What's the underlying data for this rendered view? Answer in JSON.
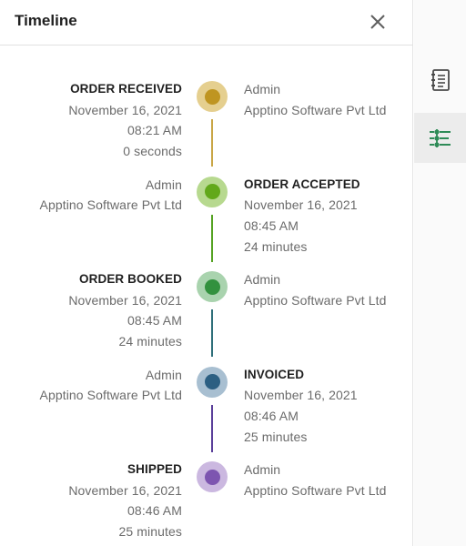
{
  "header": {
    "title": "Timeline"
  },
  "events": [
    {
      "status": "ORDER RECEIVED",
      "date": "November 16, 2021",
      "time": "08:21 AM",
      "duration": "0 seconds",
      "user": "Admin",
      "company": "Apptino Software Pvt Ltd",
      "status_side": "left",
      "ring_color": "#e5cf8f",
      "dot_color": "#bf9521",
      "connector_color": "#c9a646"
    },
    {
      "status": "ORDER ACCEPTED",
      "date": "November 16, 2021",
      "time": "08:45 AM",
      "duration": "24 minutes",
      "user": "Admin",
      "company": "Apptino Software Pvt Ltd",
      "status_side": "right",
      "ring_color": "#b7d98f",
      "dot_color": "#62a81a",
      "connector_color": "#55a323"
    },
    {
      "status": "ORDER BOOKED",
      "date": "November 16, 2021",
      "time": "08:45 AM",
      "duration": "24 minutes",
      "user": "Admin",
      "company": "Apptino Software Pvt Ltd",
      "status_side": "left",
      "ring_color": "#a9d3ae",
      "dot_color": "#32913e",
      "connector_color": "#2f6f7a"
    },
    {
      "status": "INVOICED",
      "date": "November 16, 2021",
      "time": "08:46 AM",
      "duration": "25 minutes",
      "user": "Admin",
      "company": "Apptino Software Pvt Ltd",
      "status_side": "right",
      "ring_color": "#a8bfd1",
      "dot_color": "#2c5f82",
      "connector_color": "#5a3f9a"
    },
    {
      "status": "SHIPPED",
      "date": "November 16, 2021",
      "time": "08:46 AM",
      "duration": "25 minutes",
      "user": "Admin",
      "company": "Apptino Software Pvt Ltd",
      "status_side": "left",
      "ring_color": "#cbb8e0",
      "dot_color": "#7d55b0",
      "connector_color": ""
    }
  ],
  "rail": {
    "icons": [
      "notebook-icon",
      "timeline-icon"
    ],
    "active": "timeline-icon",
    "accent": "#2e8b57"
  }
}
